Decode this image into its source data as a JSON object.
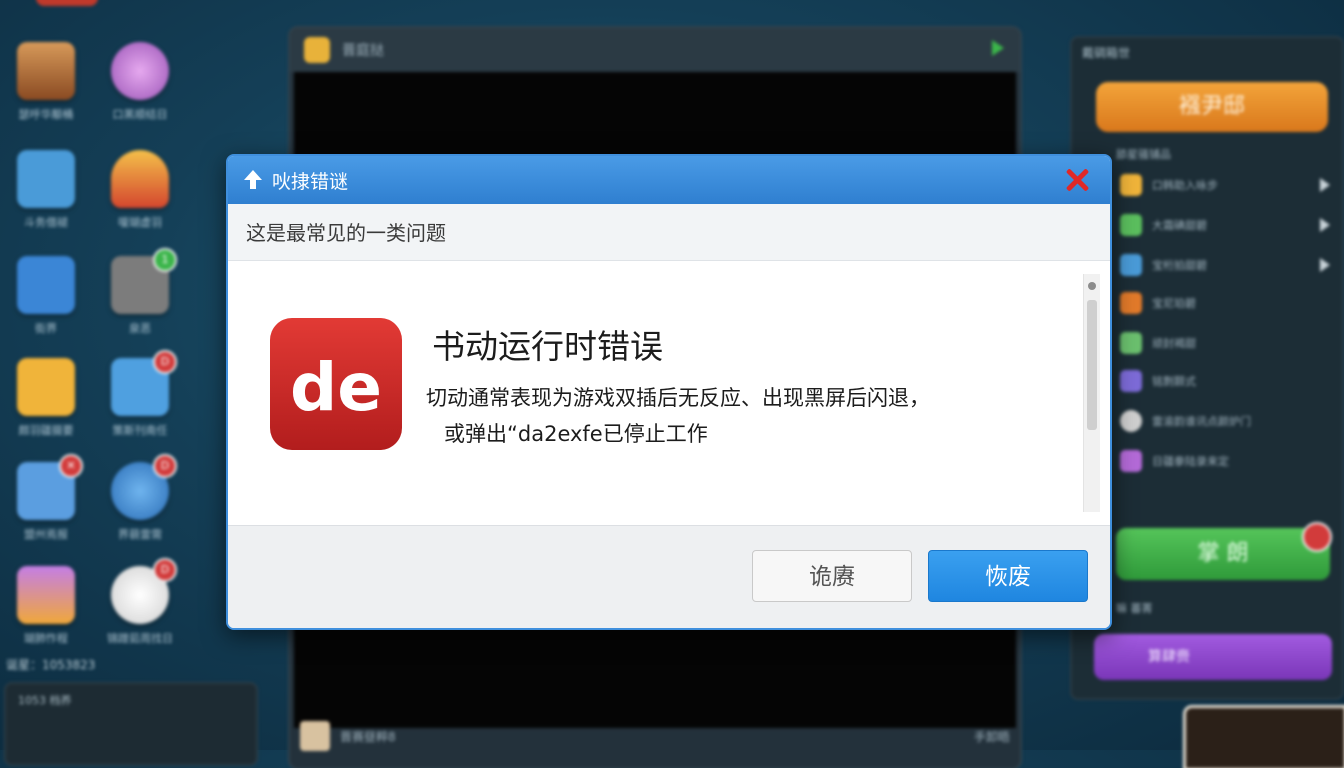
{
  "dialog": {
    "title": "吙捸错谜",
    "subtitle": "这是最常见的一类问题",
    "heading": "书动运行时错误",
    "description_line1": "切动通常表现为游戏双插后无反应、出现黑屏后闪退，",
    "description_line2": "或弹出“da2exfe已停止工作",
    "app_logo_text": "de",
    "buttons": {
      "cancel": "诡赓",
      "confirm": "恢废"
    }
  },
  "background": {
    "game_window_title": "晋庭挞",
    "status_text": "诞星：1053823",
    "desktop_icons": [
      {
        "label": "瑟呼华颙桶",
        "color": "#c9874a"
      },
      {
        "label": "口黑顺结日",
        "color": "#b96bc7"
      },
      {
        "label": "斗务借褪",
        "color": "#4a9bd8"
      },
      {
        "label": "嗄瑚虚羽",
        "color": "#e0563a"
      },
      {
        "label": "街界",
        "color": "#3b86d6"
      },
      {
        "label": "泉恶",
        "color": "#8a8a8a",
        "badge": "1"
      },
      {
        "label": "颇羽疆摄要",
        "color": "#f0b43a"
      },
      {
        "label": "策斯刊南任",
        "color": "#4fa0e0",
        "badge": "D"
      },
      {
        "label": "盟州焉报",
        "color": "#5b9ee0",
        "badge": ""
      },
      {
        "label": "界藐雷需",
        "color": "#3a80c9",
        "badge": "D"
      },
      {
        "label": "瑚肺怍程",
        "color": "#b46ad8"
      },
      {
        "label": "锦蹭茹周找日",
        "color": "#e9e9e9",
        "badge": "D"
      }
    ],
    "right_panel": {
      "title": "戴碉箱世",
      "orange_button": "襁尹邸",
      "section_label": "舔星骚铺品",
      "rows": [
        "口韩助入咏步",
        "大霜碘甜碧",
        "宝桁拍甜碧",
        "宝尼珀碧",
        "顽封褐甜",
        "铭剽颢式",
        "雷渝韵谁讯点颜炉门",
        "日疆豢陆录来定"
      ],
      "green_button": "掌  朗",
      "section_label2": "嘛  蕃菁",
      "purple_button": "算肆赍"
    },
    "bottom_panel_text": "1053 档养",
    "bottom_bar_text": "晋赛昼粹8",
    "bottom_bar_right": "手卸晤"
  }
}
